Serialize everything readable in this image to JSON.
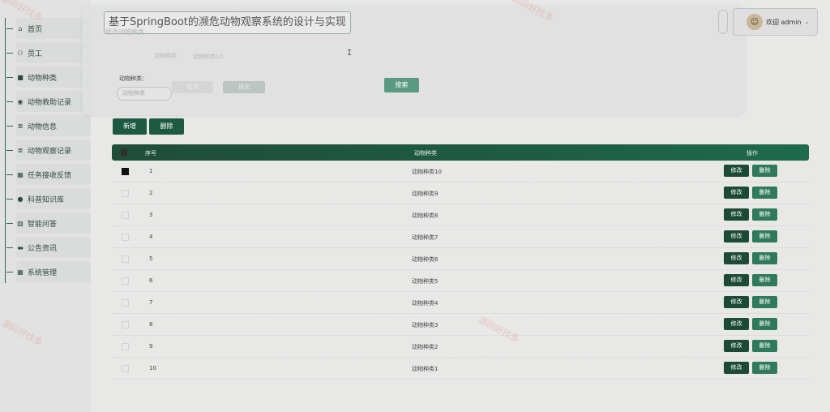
{
  "app_title": "基于SpringBoot的濒危动物观察系统的设计与实现",
  "breadcrumb": "修改动物种类",
  "header": {
    "faint_text_1": "动物种类",
    "faint_text_2": "动物种类10",
    "user_label": "欢迎 admin",
    "avatar": "☺"
  },
  "sidebar": {
    "items": [
      {
        "label": "首页",
        "icon": "⌂"
      },
      {
        "label": "员工",
        "icon": "⚇"
      },
      {
        "label": "动物种类",
        "icon": "■"
      },
      {
        "label": "动物救助记录",
        "icon": "◉"
      },
      {
        "label": "动物信息",
        "icon": "≣"
      },
      {
        "label": "动物观察记录",
        "icon": "≣"
      },
      {
        "label": "任务接收反馈",
        "icon": "▦"
      },
      {
        "label": "科普知识库",
        "icon": "●"
      },
      {
        "label": "智能问答",
        "icon": "▨"
      },
      {
        "label": "公告资讯",
        "icon": "▬"
      },
      {
        "label": "系统管理",
        "icon": "▦"
      }
    ]
  },
  "filter": {
    "label": "动物种类：",
    "placeholder": "动物种类",
    "ghost_btn_1": "取消",
    "ghost_btn_2": "提交",
    "search_label": "搜索"
  },
  "toolbar": {
    "add_label": "新增",
    "delete_label": "删除"
  },
  "table": {
    "headers": {
      "no": "序号",
      "type": "动物种类",
      "op": "操作"
    },
    "edit_label": "修改",
    "delete_label": "删除",
    "rows": [
      {
        "no": "1",
        "type": "动物种类10",
        "checked": true
      },
      {
        "no": "2",
        "type": "动物种类9",
        "checked": false
      },
      {
        "no": "3",
        "type": "动物种类8",
        "checked": false
      },
      {
        "no": "4",
        "type": "动物种类7",
        "checked": false
      },
      {
        "no": "5",
        "type": "动物种类6",
        "checked": false
      },
      {
        "no": "6",
        "type": "动物种类5",
        "checked": false
      },
      {
        "no": "7",
        "type": "动物种类4",
        "checked": false
      },
      {
        "no": "8",
        "type": "动物种类3",
        "checked": false
      },
      {
        "no": "9",
        "type": "动物种类2",
        "checked": false
      },
      {
        "no": "10",
        "type": "动物种类1",
        "checked": false
      }
    ]
  },
  "watermark_text": "源码好找多"
}
